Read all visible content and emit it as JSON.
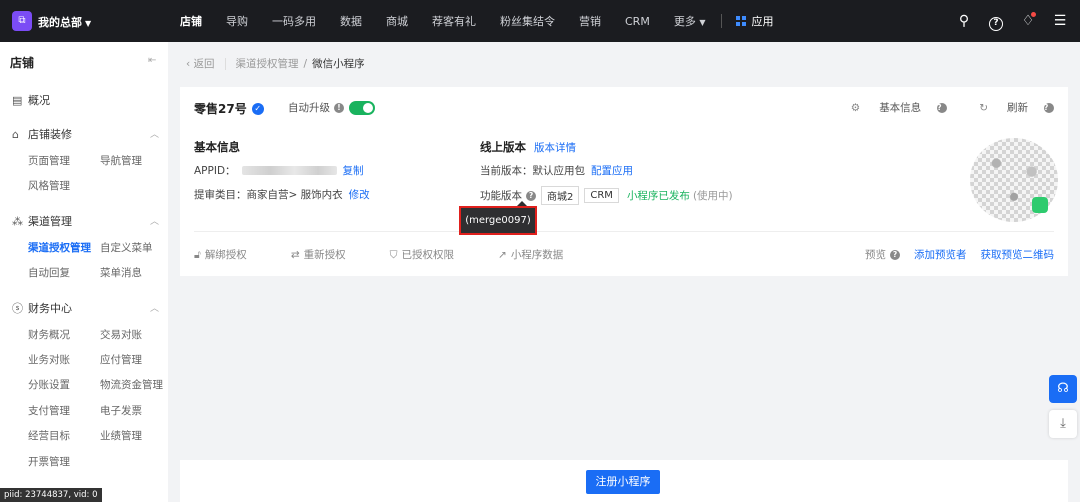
{
  "topbar": {
    "brand": "我的总部",
    "nav": [
      "店铺",
      "导购",
      "一码多用",
      "数据",
      "商城",
      "荐客有礼",
      "粉丝集结令",
      "营销",
      "CRM",
      "更多"
    ],
    "app_label": "应用"
  },
  "sidebar": {
    "title": "店铺",
    "overview": "概况",
    "sections": [
      {
        "label": "店铺装修",
        "items": [
          "页面管理",
          "导航管理",
          "风格管理"
        ]
      },
      {
        "label": "渠道管理",
        "items": [
          "渠道授权管理",
          "自定义菜单",
          "自动回复",
          "菜单消息"
        ]
      },
      {
        "label": "财务中心",
        "items": [
          "财务概况",
          "交易对账",
          "业务对账",
          "应付管理",
          "分账设置",
          "物流资金管理",
          "支付管理",
          "电子发票",
          "经营目标",
          "业绩管理",
          "开票管理"
        ]
      }
    ]
  },
  "breadcrumb": {
    "back": "返回",
    "parent": "渠道授权管理",
    "sep": "/",
    "current": "微信小程序"
  },
  "card": {
    "name": "零售27号",
    "auto_upgrade": "自动升级",
    "basic_info_link": "基本信息",
    "refresh": "刷新",
    "basic": {
      "title": "基本信息",
      "appid_label": "APPID：",
      "copy": "复制",
      "category_label": "提审类目：",
      "category_value": "商家自营> 服饰内衣",
      "modify": "修改"
    },
    "online": {
      "title": "线上版本",
      "version_detail": "版本详情",
      "current_label": "当前版本：",
      "current_value": "默认应用包",
      "config": "配置应用",
      "feature_label": "功能版本",
      "tags": [
        "商城2",
        "CRM"
      ],
      "status": "小程序已发布",
      "status_note": "(使用中)"
    },
    "actions": [
      "解绑授权",
      "重新授权",
      "已授权权限",
      "小程序数据"
    ],
    "preview": {
      "label": "预览",
      "add_previewer": "添加预览者",
      "get_qr": "获取预览二维码"
    }
  },
  "tooltip": "(merge0097)",
  "register_button": "注册小程序",
  "debug": "piid: 23744837, vid: 0"
}
